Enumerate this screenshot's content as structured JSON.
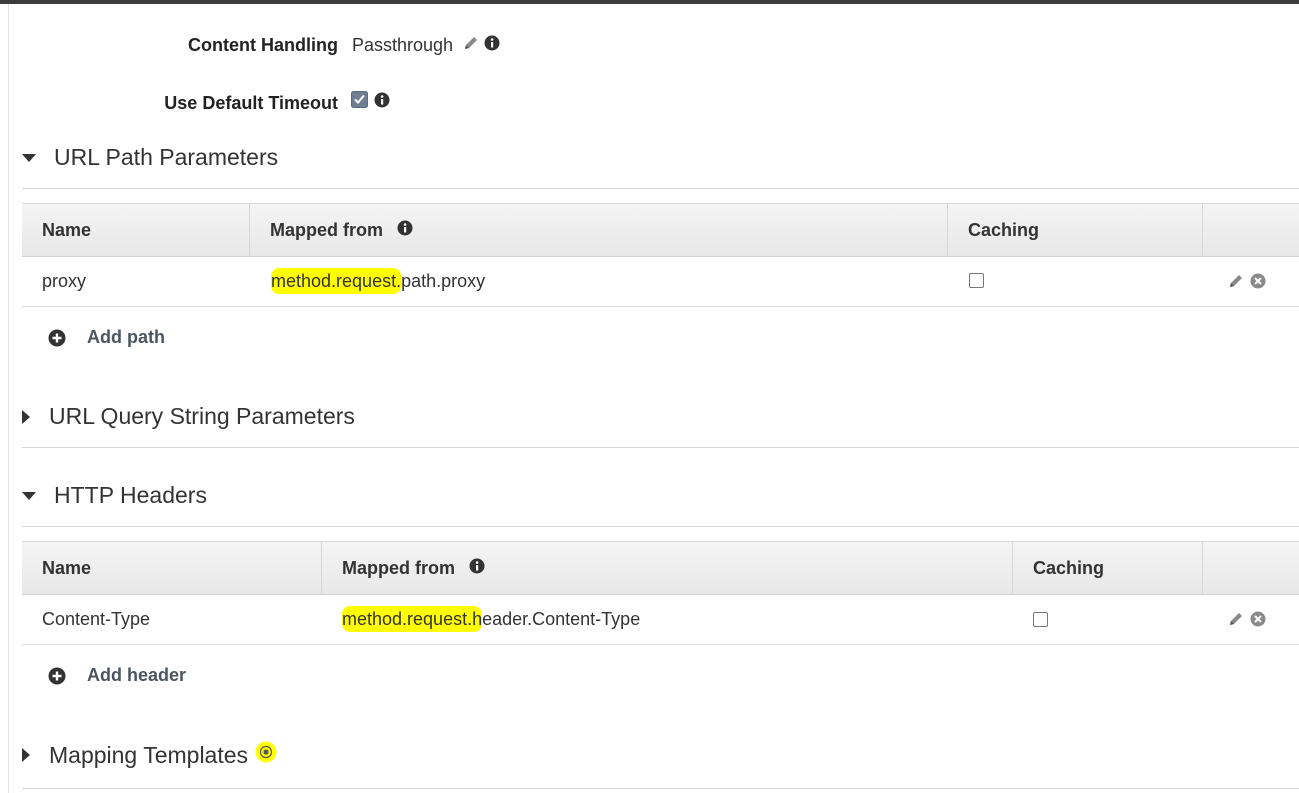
{
  "settings": {
    "content_handling_label": "Content Handling",
    "content_handling_value": "Passthrough",
    "default_timeout_label": "Use Default Timeout",
    "default_timeout_checked": true
  },
  "url_path": {
    "title": "URL Path Parameters",
    "columns": [
      "Name",
      "Mapped from",
      "Caching"
    ],
    "rows": [
      {
        "name": "proxy",
        "mapped_highlight": "method.request.",
        "mapped_rest": "path.proxy",
        "caching": false
      }
    ],
    "add_label": "Add path"
  },
  "query_string": {
    "title": "URL Query String Parameters"
  },
  "http_headers": {
    "title": "HTTP Headers",
    "columns": [
      "Name",
      "Mapped from",
      "Caching"
    ],
    "rows": [
      {
        "name": "Content-Type",
        "mapped_highlight": "method.request.h",
        "mapped_rest": "eader.Content-Type",
        "caching": false
      }
    ],
    "add_label": "Add header"
  },
  "mapping_templates": {
    "title": "Mapping Templates"
  },
  "colors": {
    "highlight": "#ffff00",
    "header_bg": "#ededed",
    "link": "#4a5560"
  },
  "icons": [
    "pencil-icon",
    "info-icon",
    "checkbox-checked-icon",
    "remove-icon",
    "add-circle-icon",
    "caret-down-icon",
    "caret-right-icon"
  ]
}
